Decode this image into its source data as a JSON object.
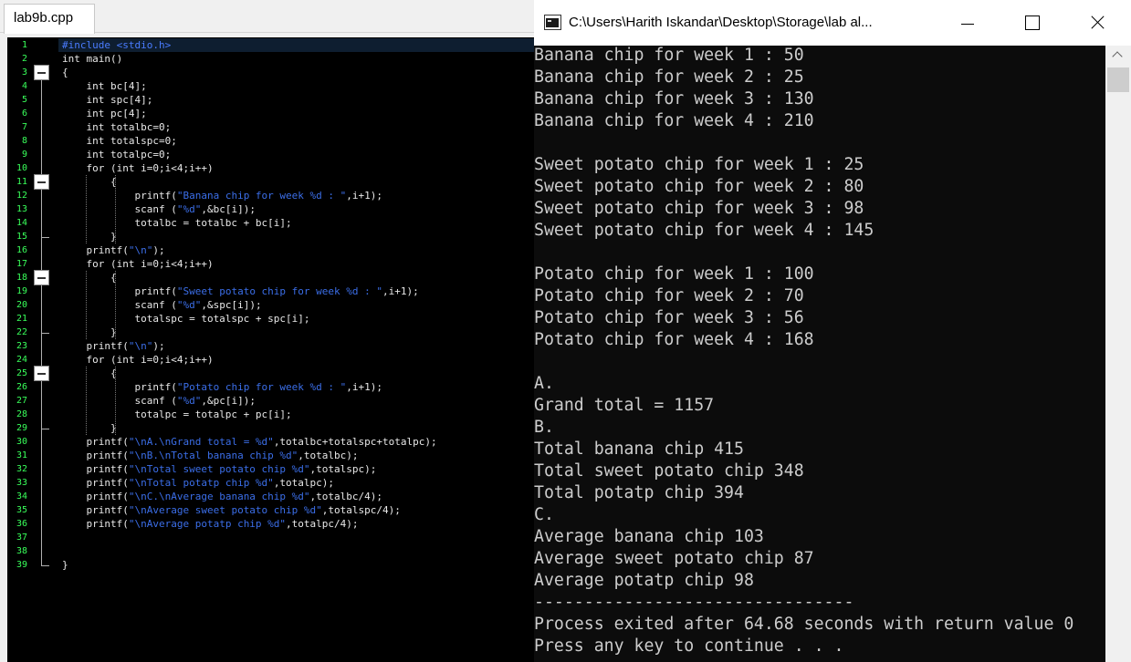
{
  "editor": {
    "tab_label": "lab9b.cpp",
    "code_lines": [
      "#include <stdio.h>",
      "int main()",
      "{",
      "    int bc[4];",
      "    int spc[4];",
      "    int pc[4];",
      "    int totalbc=0;",
      "    int totalspc=0;",
      "    int totalpc=0;",
      "    for (int i=0;i<4;i++)",
      "        {",
      "            printf(\"Banana chip for week %d : \",i+1);",
      "            scanf (\"%d\",&bc[i]);",
      "            totalbc = totalbc + bc[i];",
      "        }",
      "    printf(\"\\n\");",
      "    for (int i=0;i<4;i++)",
      "        {",
      "            printf(\"Sweet potato chip for week %d : \",i+1);",
      "            scanf (\"%d\",&spc[i]);",
      "            totalspc = totalspc + spc[i];",
      "        }",
      "    printf(\"\\n\");",
      "    for (int i=0;i<4;i++)",
      "        {",
      "            printf(\"Potato chip for week %d : \",i+1);",
      "            scanf (\"%d\",&pc[i]);",
      "            totalpc = totalpc + pc[i];",
      "        }",
      "    printf(\"\\nA.\\nGrand total = %d\",totalbc+totalspc+totalpc);",
      "    printf(\"\\nB.\\nTotal banana chip %d\",totalbc);",
      "    printf(\"\\nTotal sweet potato chip %d\",totalspc);",
      "    printf(\"\\nTotal potatp chip %d\",totalpc);",
      "    printf(\"\\nC.\\nAverage banana chip %d\",totalbc/4);",
      "    printf(\"\\nAverage sweet potato chip %d\",totalspc/4);",
      "    printf(\"\\nAverage potatp chip %d\",totalpc/4);",
      "",
      "",
      "}"
    ]
  },
  "console": {
    "title": "C:\\Users\\Harith Iskandar\\Desktop\\Storage\\lab al...",
    "output_lines": [
      "Banana chip for week 1 : 50",
      "Banana chip for week 2 : 25",
      "Banana chip for week 3 : 130",
      "Banana chip for week 4 : 210",
      "",
      "Sweet potato chip for week 1 : 25",
      "Sweet potato chip for week 2 : 80",
      "Sweet potato chip for week 3 : 98",
      "Sweet potato chip for week 4 : 145",
      "",
      "Potato chip for week 1 : 100",
      "Potato chip for week 2 : 70",
      "Potato chip for week 3 : 56",
      "Potato chip for week 4 : 168",
      "",
      "A.",
      "Grand total = 1157",
      "B.",
      "Total banana chip 415",
      "Total sweet potato chip 348",
      "Total potatp chip 394",
      "C.",
      "Average banana chip 103",
      "Average sweet potato chip 87",
      "Average potatp chip 98",
      "--------------------------------",
      "Process exited after 64.68 seconds with return value 0",
      "Press any key to continue . . ."
    ]
  },
  "colors": {
    "line_number": "#39ff5a",
    "preprocessor": "#4a7cff",
    "string": "#3b6ee8",
    "code_text": "#e8e8e8",
    "console_text": "#cccccc",
    "console_bg": "#0c0c0c"
  },
  "icons": [
    "console-window-icon",
    "minimize-icon",
    "maximize-icon",
    "close-icon",
    "fold-collapse-icon",
    "scroll-up-arrow-icon"
  ]
}
